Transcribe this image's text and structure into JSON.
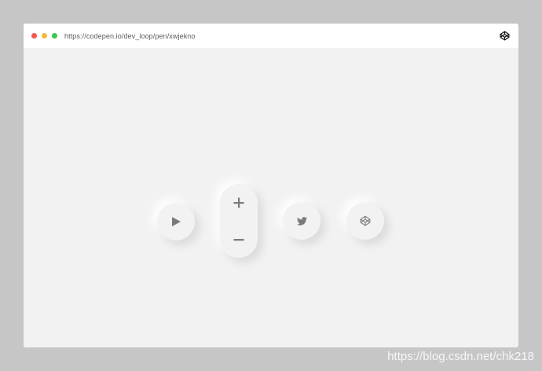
{
  "browser": {
    "url": "https://codepen.io/dev_loop/pen/xwjekno",
    "traffic_lights": [
      "#f0584f",
      "#f5b93a",
      "#3cc44f"
    ],
    "logo_icon": "codepen-icon"
  },
  "buttons": [
    {
      "name": "play",
      "icon": "play-icon"
    },
    {
      "name": "zoom",
      "icons": [
        "plus-icon",
        "minus-icon"
      ]
    },
    {
      "name": "twitter",
      "icon": "twitter-icon"
    },
    {
      "name": "codepen",
      "icon": "codepen-icon"
    }
  ],
  "colors": {
    "page_bg": "#c6c6c6",
    "surface": "#f2f2f2",
    "icon": "#7a7a7a"
  },
  "watermark": "https://blog.csdn.net/chk218"
}
